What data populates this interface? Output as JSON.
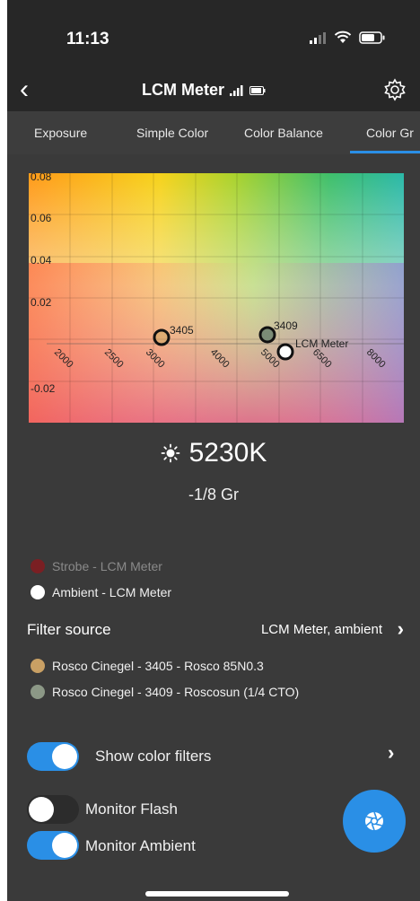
{
  "status_bar": {
    "time": "11:13"
  },
  "nav": {
    "title": "LCM Meter"
  },
  "tabs": [
    {
      "label": "Exposure"
    },
    {
      "label": "Simple Color"
    },
    {
      "label": "Color Balance"
    },
    {
      "label": "Color Gr",
      "active": true
    }
  ],
  "chart_data": {
    "type": "scatter",
    "y_ticks": [
      "0.08",
      "0.06",
      "0.04",
      "0.02",
      "-0.02"
    ],
    "x_ticks": [
      "2000",
      "2500",
      "3000",
      "4000",
      "5000",
      "6500",
      "8000"
    ],
    "points": [
      {
        "label": "3405",
        "color": "#3d3d3d"
      },
      {
        "label": "3409",
        "color": "#7b8c77"
      },
      {
        "label": "LCM Meter",
        "color": "#ffffff"
      }
    ]
  },
  "readout": {
    "temperature": "5230K",
    "tint": "-1/8 Gr"
  },
  "legend": [
    {
      "label": "Strobe - LCM Meter",
      "color": "#7a1f23",
      "dimmed": true
    },
    {
      "label": "Ambient - LCM Meter",
      "color": "#ffffff",
      "dimmed": false
    }
  ],
  "filter_source": {
    "label": "Filter source",
    "value": "LCM Meter, ambient"
  },
  "filters": [
    {
      "label": "Rosco Cinegel - 3405 - Rosco 85N0.3",
      "color": "#c9a064"
    },
    {
      "label": "Rosco Cinegel - 3409 - Roscosun (1/4 CTO)",
      "color": "#8c9886"
    }
  ],
  "toggles": {
    "show_color_filters": {
      "label": "Show color filters",
      "on": true
    },
    "monitor_flash": {
      "label": "Monitor Flash",
      "on": false
    },
    "monitor_ambient": {
      "label": "Monitor Ambient",
      "on": true
    }
  },
  "colors": {
    "accent": "#2a8fe6",
    "background": "#3a3a3a",
    "bar": "#272727"
  }
}
